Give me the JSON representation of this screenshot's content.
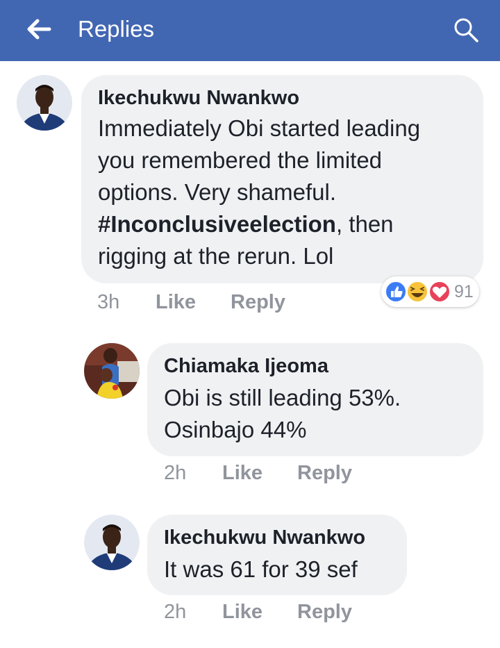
{
  "header": {
    "title": "Replies",
    "back_icon": "back-arrow-icon",
    "search_icon": "search-icon",
    "bar_color": "#4267b2"
  },
  "comments": [
    {
      "author": "Ikechukwu Nwankwo",
      "lines": [
        "Immediately Obi started leading",
        "you remembered the limited",
        "options.  Very shameful."
      ],
      "hashtag": "#Inconclusiveelection",
      "hashtag_after": ",  then",
      "last_line": "rigging at the rerun.  Lol",
      "time": "3h",
      "like": "Like",
      "reply": "Reply",
      "reaction_count": "91",
      "reaction_icons": [
        "like-reaction-icon",
        "haha-reaction-icon",
        "love-reaction-icon"
      ]
    },
    {
      "author": "Chiamaka Ijeoma",
      "lines": [
        "Obi is still leading 53%.",
        "Osinbajo 44%"
      ],
      "time": "2h",
      "like": "Like",
      "reply": "Reply"
    },
    {
      "author": "Ikechukwu Nwankwo",
      "lines": [
        "It was 61 for 39 sef"
      ],
      "time": "2h",
      "like": "Like",
      "reply": "Reply"
    }
  ],
  "colors": {
    "bubble": "#f0f1f3",
    "meta": "#90949c",
    "text": "#1d2129",
    "like_blue": "#3b7cf5",
    "love_red": "#e8425a",
    "haha_yellow": "#f7c33b"
  }
}
